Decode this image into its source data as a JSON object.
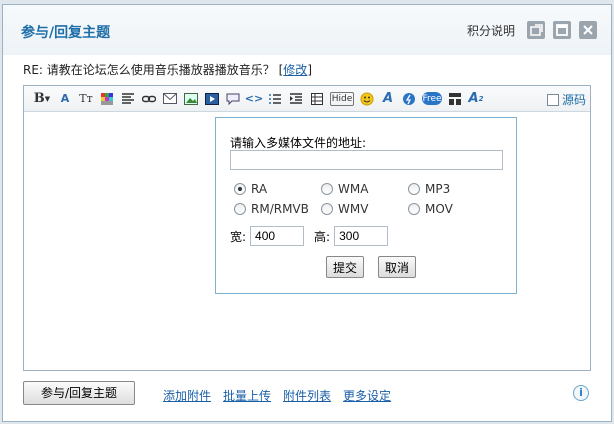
{
  "dialog": {
    "title": "参与/回复主题",
    "help_link": "积分说明",
    "buttons": [
      "restore-icon",
      "maximize-icon",
      "close-icon"
    ]
  },
  "subject": {
    "text": "RE: 请教在论坛怎么使用音乐播放器播放音乐？",
    "edit_link": "修改"
  },
  "toolbar": {
    "icons": [
      "bold-icon",
      "font-icon",
      "font-size-icon",
      "color-icon",
      "align-icon",
      "link-icon",
      "email-icon",
      "image-icon",
      "media-icon",
      "quote-icon",
      "code-icon",
      "ordered-list-icon",
      "indent-icon",
      "table-icon",
      "hide-icon",
      "smiley-icon",
      "text-style-icon",
      "flash-icon",
      "free-icon",
      "layout-icon",
      "superscript-icon"
    ],
    "bold_label": "B",
    "hide_label": "Hide",
    "free_label": "Free",
    "source_label": "源码"
  },
  "media_popup": {
    "prompt": "请输入多媒体文件的地址:",
    "url_value": "",
    "formats": [
      {
        "label": "RA",
        "selected": true
      },
      {
        "label": "WMA",
        "selected": false
      },
      {
        "label": "MP3",
        "selected": false
      },
      {
        "label": "RM/RMVB",
        "selected": false
      },
      {
        "label": "WMV",
        "selected": false
      },
      {
        "label": "MOV",
        "selected": false
      }
    ],
    "width_label": "宽:",
    "width_value": "400",
    "height_label": "高:",
    "height_value": "300",
    "submit_label": "提交",
    "cancel_label": "取消"
  },
  "footer": {
    "submit_label": "参与/回复主题",
    "links": [
      "添加附件",
      "批量上传",
      "附件列表",
      "更多设定"
    ]
  }
}
